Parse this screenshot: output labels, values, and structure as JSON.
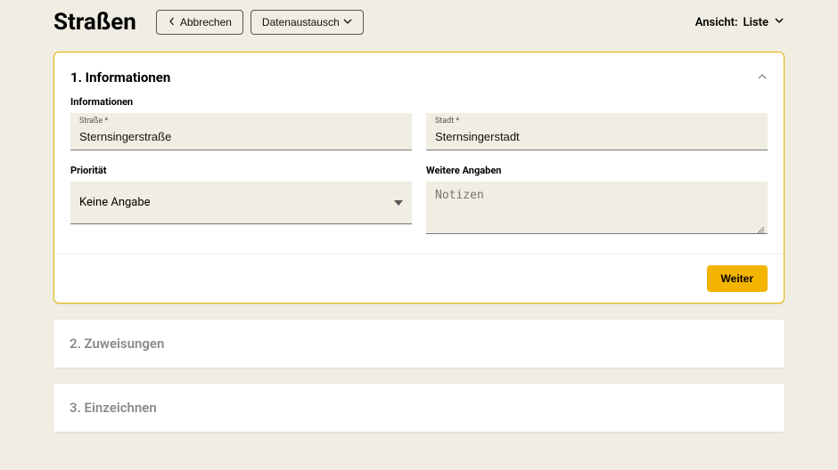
{
  "header": {
    "title": "Straßen",
    "cancel_label": "Abbrechen",
    "exchange_label": "Datenaustausch",
    "view_label_prefix": "Ansicht:",
    "view_value": "Liste"
  },
  "step1": {
    "title": "1. Informationen",
    "section_label": "Informationen",
    "street_label": "Straße *",
    "street_value": "Sternsingerstraße",
    "city_label": "Stadt *",
    "city_value": "Sternsingerstadt",
    "priority_label": "Priorität",
    "priority_value": "Keine Angabe",
    "more_label": "Weitere Angaben",
    "notes_placeholder": "Notizen",
    "next_label": "Weiter"
  },
  "step2": {
    "title": "2. Zuweisungen"
  },
  "step3": {
    "title": "3. Einzeichnen"
  }
}
